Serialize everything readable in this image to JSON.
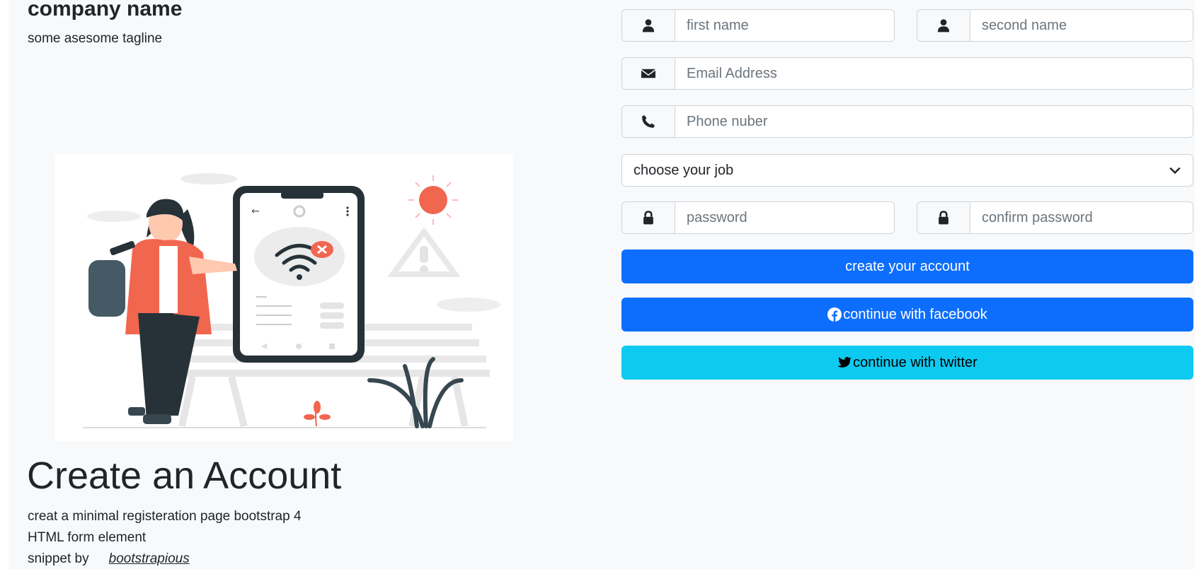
{
  "brand": {
    "name": "company name",
    "tagline": "some asesome tagline"
  },
  "hero": {
    "headline": "Create an Account",
    "description_line1": "creat a minimal registeration page bootstrap 4",
    "description_line2": "HTML form element",
    "credit_prefix": "snippet by",
    "credit_link": "bootstrapious"
  },
  "form": {
    "first_name": {
      "placeholder": "first name",
      "icon": "user-icon"
    },
    "second_name": {
      "placeholder": "second name",
      "icon": "user-icon"
    },
    "email": {
      "placeholder": "Email Address",
      "icon": "envelope-icon"
    },
    "phone": {
      "placeholder": "Phone nuber",
      "icon": "phone-icon"
    },
    "job_select": {
      "selected": "choose your job"
    },
    "password": {
      "placeholder": "password",
      "icon": "lock-icon"
    },
    "confirm_password": {
      "placeholder": "confirm password",
      "icon": "lock-icon"
    },
    "create_button": "create your account",
    "facebook_button": "continue with facebook",
    "twitter_button": "continue with twitter"
  },
  "colors": {
    "primary": "#0d6efd",
    "info": "#0dcaf0",
    "background": "#f8f9fa",
    "accent": "#f1664f"
  }
}
